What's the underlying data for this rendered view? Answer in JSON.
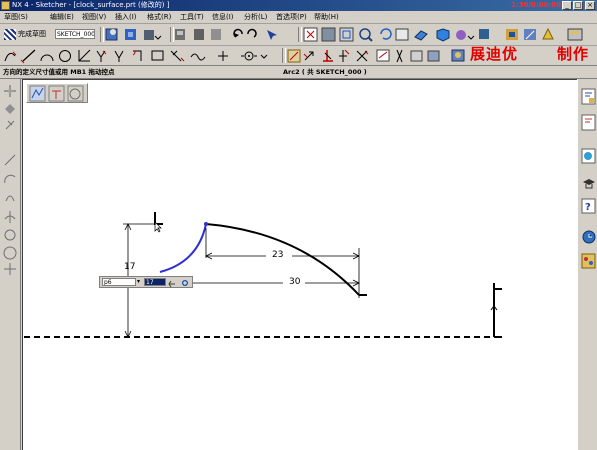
{
  "window": {
    "title": "NX 4 - Sketcher - [clock_surface.prt (修改的) ]",
    "clock": "1:30/0:00:00",
    "controls": [
      "_",
      "□",
      "×"
    ]
  },
  "menu": [
    "草图(S)",
    "编辑(E)",
    "视图(V)",
    "插入(I)",
    "格式(R)",
    "工具(T)",
    "信息(I)",
    "分析(L)",
    "首选项(P)",
    "帮助(H)"
  ],
  "toolbar": {
    "finish_label": "完成草图",
    "sketch_name": "SKETCH_000"
  },
  "watermark": {
    "name": "展迪优",
    "made": "制作"
  },
  "cue": {
    "left": "方向的定义尺寸值或用 MB1 拖动控点",
    "right": "Arc2 ( 共 SKETCH_000 )"
  },
  "canvas": {
    "dims": {
      "vertical": "17",
      "horizontal_short": "23",
      "horizontal_long": "30"
    },
    "dim_editor": {
      "name": "p6",
      "value": "17"
    }
  },
  "colors": {
    "selected_arc": "#3030d0",
    "geometry": "#000000",
    "title_start": "#0a246a",
    "title_end": "#3a6ea5",
    "watermark": "#e00000"
  }
}
